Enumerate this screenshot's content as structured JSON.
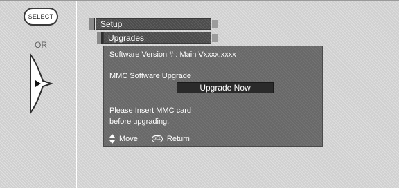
{
  "remote": {
    "select_key": "SELECT",
    "or_label": "OR",
    "icons": [
      "dpad-right-icon"
    ]
  },
  "menu": {
    "title": "Setup",
    "submenu": "Upgrades"
  },
  "panel": {
    "version_line": "Software Version # : Main Vxxxx.xxxx",
    "mmc_heading": "MMC Software Upgrade",
    "upgrade_button": "Upgrade Now",
    "message_line1": "Please Insert MMC card",
    "message_line2": "before upgrading."
  },
  "footer": {
    "move_label": "Move",
    "sel_key": "SEL",
    "return_label": "Return"
  },
  "colors": {
    "bar": "#4c4c4c",
    "panel": "#686868",
    "button": "#2a2a2a",
    "background": "#d0d0d0"
  }
}
